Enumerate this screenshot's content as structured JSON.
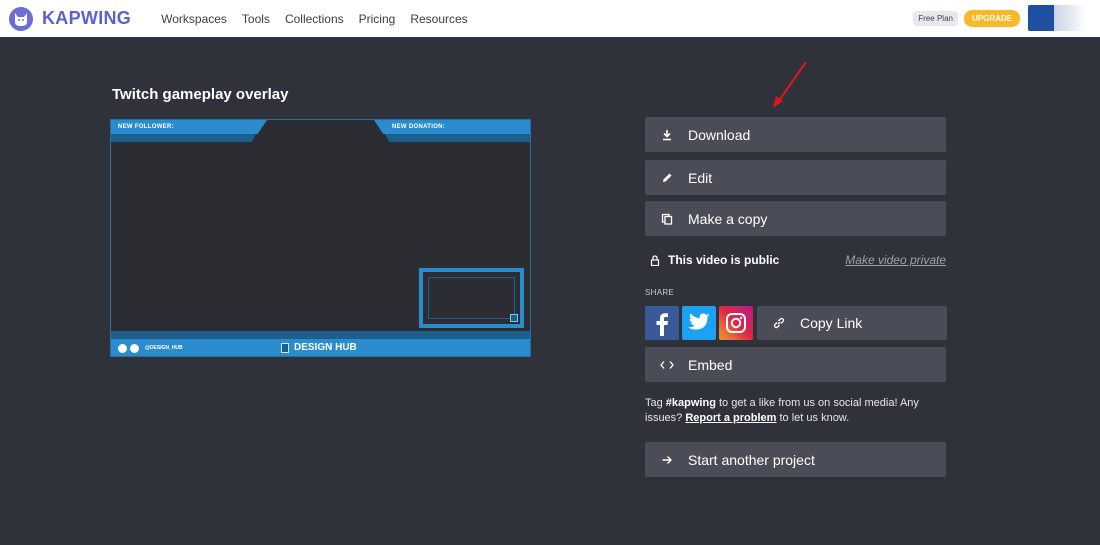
{
  "header": {
    "brand": "KAPWING",
    "nav": [
      "Workspaces",
      "Tools",
      "Collections",
      "Pricing",
      "Resources"
    ],
    "plan_badge": "Free Plan",
    "upgrade_label": "UPGRADE"
  },
  "project": {
    "title": "Twitch gameplay overlay",
    "overlay": {
      "left_label": "NEW FOLLOWER:",
      "right_label": "NEW DONATION:",
      "handle": "@DESIGN_HUB",
      "brand": "DESIGN HUB"
    }
  },
  "actions": {
    "download": "Download",
    "edit": "Edit",
    "copy": "Make a copy",
    "privacy_status": "This video is public",
    "privacy_link": "Make video private",
    "share_label": "SHARE",
    "copy_link": "Copy Link",
    "embed": "Embed",
    "tagline_prefix": "Tag ",
    "tagline_hashtag": "#kapwing",
    "tagline_middle": " to get a like from us on social media! Any issues? ",
    "tagline_report": "Report a problem",
    "tagline_suffix": " to let us know.",
    "start": "Start another project"
  },
  "colors": {
    "background": "#2f323a",
    "button": "#4a4d57",
    "brand": "#5d61cf",
    "upgrade": "#f7b928",
    "overlay_blue": "#2b8ccd",
    "annotation_arrow": "#e0161c"
  }
}
